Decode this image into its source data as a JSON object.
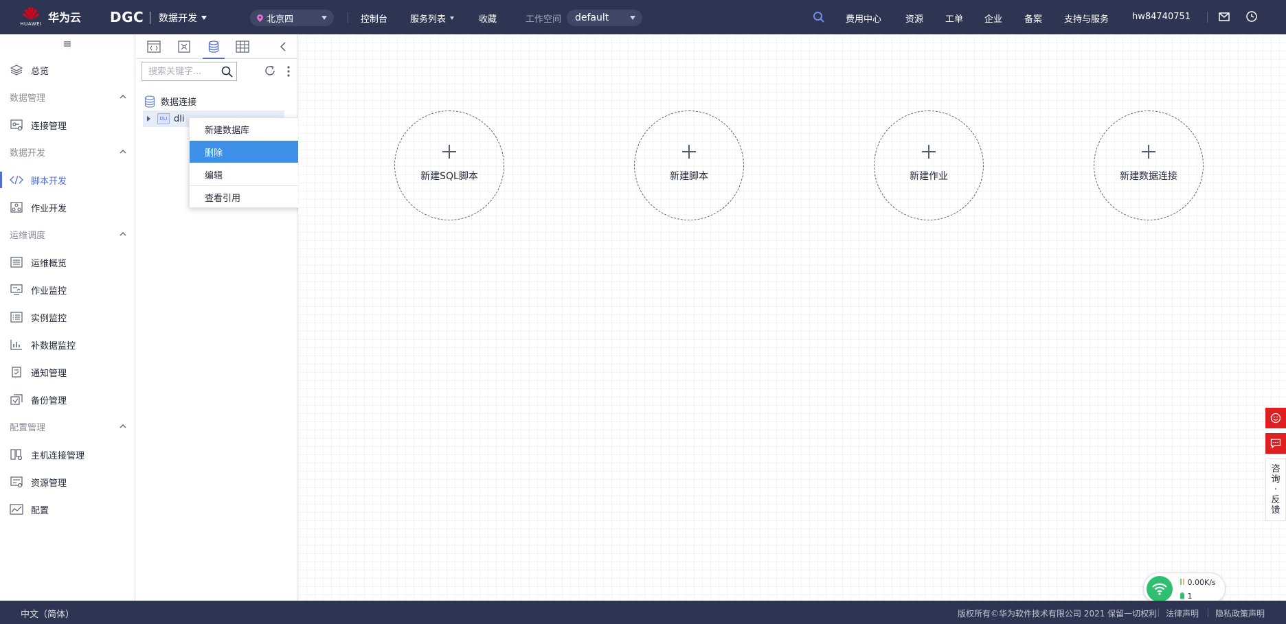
{
  "brand": {
    "logo_text": "华为云",
    "logo_sub": "HUAWEI",
    "product": "DGC",
    "module": "数据开发"
  },
  "region": "北京四",
  "topnav": {
    "console": "控制台",
    "services": "服务列表",
    "favorites": "收藏"
  },
  "workspace": {
    "label": "工作空间",
    "value": "default"
  },
  "topright": {
    "billing": "费用中心",
    "resources": "资源",
    "tickets": "工单",
    "enterprise": "企业",
    "filing": "备案",
    "support": "支持与服务",
    "user": "hw84740751"
  },
  "sidebar": {
    "overview": "总览",
    "groups": {
      "data_mgmt": "数据管理",
      "data_dev": "数据开发",
      "ops": "运维调度",
      "config_mgmt": "配置管理"
    },
    "items": {
      "conn_mgmt": "连接管理",
      "script_dev": "脚本开发",
      "job_dev": "作业开发",
      "ops_overview": "运维概览",
      "job_monitor": "作业监控",
      "instance_monitor": "实例监控",
      "backfill_monitor": "补数据监控",
      "notify_mgmt": "通知管理",
      "backup_mgmt": "备份管理",
      "host_conn_mgmt": "主机连接管理",
      "resource_mgmt": "资源管理",
      "config": "配置"
    }
  },
  "tree": {
    "search_placeholder": "搜索关键字...",
    "root": "数据连接",
    "node_label": "dli",
    "node_icon": "DLI"
  },
  "context_menu": {
    "new_db": "新建数据库",
    "delete": "删除",
    "edit": "编辑",
    "view_refs": "查看引用"
  },
  "quick_actions": {
    "new_sql": "新建SQL脚本",
    "new_script": "新建脚本",
    "new_job": "新建作业",
    "new_conn": "新建数据连接"
  },
  "float": {
    "consult": [
      "咨",
      "询",
      "·",
      "反",
      "馈"
    ]
  },
  "network": {
    "speed": "0.00K/s",
    "count": "1"
  },
  "footer": {
    "lang": "中文（简体）",
    "copyright": "版权所有©华为软件技术有限公司 2021 保留一切权利",
    "legal": "法律声明",
    "privacy": "隐私政策声明"
  },
  "colors": {
    "topbar": "#2e3552",
    "accent": "#526ecc",
    "menu_highlight": "#3d8fe8",
    "fab_red": "#e02020",
    "wifi_green": "#2fbf71"
  }
}
